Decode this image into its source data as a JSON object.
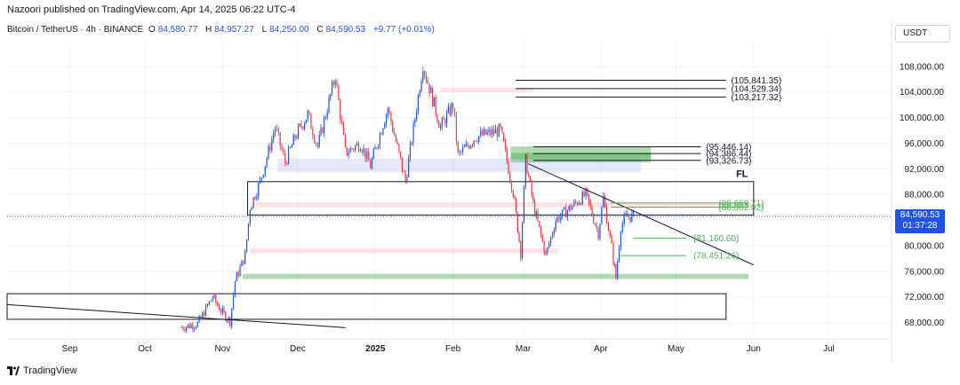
{
  "header": {
    "published": "Nazoori published on TradingView.com, Apr 14, 2025 06:22 UTC-4",
    "symbol": "Bitcoin / TetherUS · 4h · BINANCE",
    "open_label": "O",
    "open": "84,580.77",
    "high_label": "H",
    "high": "84,957.27",
    "low_label": "L",
    "low": "84,250.00",
    "close_label": "C",
    "close": "84,590.53",
    "change": "+9.77 (+0.01%)",
    "currency": "USDT"
  },
  "price_badge": {
    "price": "84,590.53",
    "countdown": "01:37:28"
  },
  "footer": {
    "brand": "TradingView"
  },
  "colors": {
    "accent": "#1e53e5",
    "up": "#4caf50",
    "down": "#f23645",
    "line": "#131722"
  },
  "chart_data": {
    "type": "candlestick",
    "y_ticks": [
      "108,000.00",
      "104,000.00",
      "100,000.00",
      "96,000.00",
      "92,000.00",
      "88,000.00",
      "84,000.00",
      "80,000.00",
      "76,000.00",
      "72,000.00",
      "68,000.00"
    ],
    "ylim": [
      66000,
      112000
    ],
    "x_ticks": [
      {
        "label": "Sep",
        "date": "2024-09-01"
      },
      {
        "label": "Oct",
        "date": "2024-10-01"
      },
      {
        "label": "Nov",
        "date": "2024-11-01"
      },
      {
        "label": "Dec",
        "date": "2024-12-01"
      },
      {
        "label": "2025",
        "date": "2025-01-01"
      },
      {
        "label": "Feb",
        "date": "2025-02-01"
      },
      {
        "label": "Mar",
        "date": "2025-03-01"
      },
      {
        "label": "Apr",
        "date": "2025-04-01"
      },
      {
        "label": "May",
        "date": "2025-05-01"
      },
      {
        "label": "Jun",
        "date": "2025-06-01"
      },
      {
        "label": "Jul",
        "date": "2025-07-01"
      }
    ],
    "xlim": [
      "2024-08-07",
      "2025-07-25"
    ],
    "current_price": 84590.53,
    "price_series": [
      [
        "2024-10-15",
        67200
      ],
      [
        "2024-10-22",
        67800
      ],
      [
        "2024-10-28",
        72000
      ],
      [
        "2024-11-01",
        69500
      ],
      [
        "2024-11-04",
        68200
      ],
      [
        "2024-11-06",
        74500
      ],
      [
        "2024-11-10",
        78500
      ],
      [
        "2024-11-12",
        86000
      ],
      [
        "2024-11-16",
        90000
      ],
      [
        "2024-11-22",
        98500
      ],
      [
        "2024-11-26",
        93000
      ],
      [
        "2024-11-30",
        97000
      ],
      [
        "2024-12-05",
        100500
      ],
      [
        "2024-12-09",
        95500
      ],
      [
        "2024-12-16",
        106500
      ],
      [
        "2024-12-20",
        94500
      ],
      [
        "2024-12-26",
        96000
      ],
      [
        "2024-12-30",
        92500
      ],
      [
        "2025-01-06",
        101500
      ],
      [
        "2025-01-13",
        90000
      ],
      [
        "2025-01-20",
        108200
      ],
      [
        "2025-01-27",
        98500
      ],
      [
        "2025-02-01",
        102000
      ],
      [
        "2025-02-03",
        94000
      ],
      [
        "2025-02-10",
        97000
      ],
      [
        "2025-02-20",
        98000
      ],
      [
        "2025-02-25",
        88500
      ],
      [
        "2025-02-28",
        79000
      ],
      [
        "2025-03-02",
        93500
      ],
      [
        "2025-03-05",
        86500
      ],
      [
        "2025-03-10",
        78500
      ],
      [
        "2025-03-14",
        84000
      ],
      [
        "2025-03-20",
        86000
      ],
      [
        "2025-03-26",
        88000
      ],
      [
        "2025-03-31",
        82000
      ],
      [
        "2025-04-02",
        87500
      ],
      [
        "2025-04-06",
        78000
      ],
      [
        "2025-04-07",
        75000
      ],
      [
        "2025-04-09",
        83000
      ],
      [
        "2025-04-11",
        84500
      ],
      [
        "2025-04-14",
        84590
      ]
    ],
    "levels": [
      {
        "label": "(105,841.35)",
        "value": 105841.35
      },
      {
        "label": "(104,529.34)",
        "value": 104529.34
      },
      {
        "label": "(103,217.32)",
        "value": 103217.32
      },
      {
        "label": "(95,446.14)",
        "value": 95446.14
      },
      {
        "label": "(94,386.44)",
        "value": 94386.44
      },
      {
        "label": "(93,326.73)",
        "value": 93326.73
      },
      {
        "label": "(86,669.71)",
        "value": 86669.71
      },
      {
        "label": "(86,002.02)",
        "value": 86002.02
      },
      {
        "label": "(81,160.60)",
        "value": 81160.6
      },
      {
        "label": "(78,451.26)",
        "value": 78451.26
      }
    ],
    "annotations": [
      {
        "label": "FL"
      }
    ],
    "zones": [
      {
        "type": "supply",
        "from": "2025-01-27",
        "to": "2025-03-05",
        "low": 104000,
        "high": 104700
      },
      {
        "type": "demand",
        "from": "2025-02-24",
        "to": "2025-04-21",
        "low": 93000,
        "high": 95500
      },
      {
        "type": "demand",
        "from": "2025-02-24",
        "to": "2025-04-21",
        "low": 93500,
        "high": 94500
      },
      {
        "type": "neutral",
        "from": "2024-11-23",
        "to": "2025-04-17",
        "low": 91500,
        "high": 93600
      },
      {
        "type": "supply",
        "from": "2024-11-12",
        "to": "2025-05-31",
        "low": 86000,
        "high": 86800
      },
      {
        "type": "supply",
        "from": "2024-11-12",
        "to": "2025-03-15",
        "low": 78800,
        "high": 79600
      },
      {
        "type": "demand",
        "from": "2024-11-09",
        "to": "2025-05-30",
        "low": 74800,
        "high": 75600
      }
    ],
    "boxes": [
      {
        "from": "2024-11-11",
        "to": "2025-06-01",
        "low": 84800,
        "high": 90000
      },
      {
        "from": "2024-08-07",
        "to": "2025-05-21",
        "low": 68500,
        "high": 72500
      }
    ],
    "trendlines": [
      {
        "from": [
          "2025-03-03",
          92800
        ],
        "to": [
          "2025-06-01",
          77000
        ]
      },
      {
        "from": [
          "2024-08-07",
          70800
        ],
        "to": [
          "2024-12-20",
          67200
        ]
      }
    ]
  }
}
